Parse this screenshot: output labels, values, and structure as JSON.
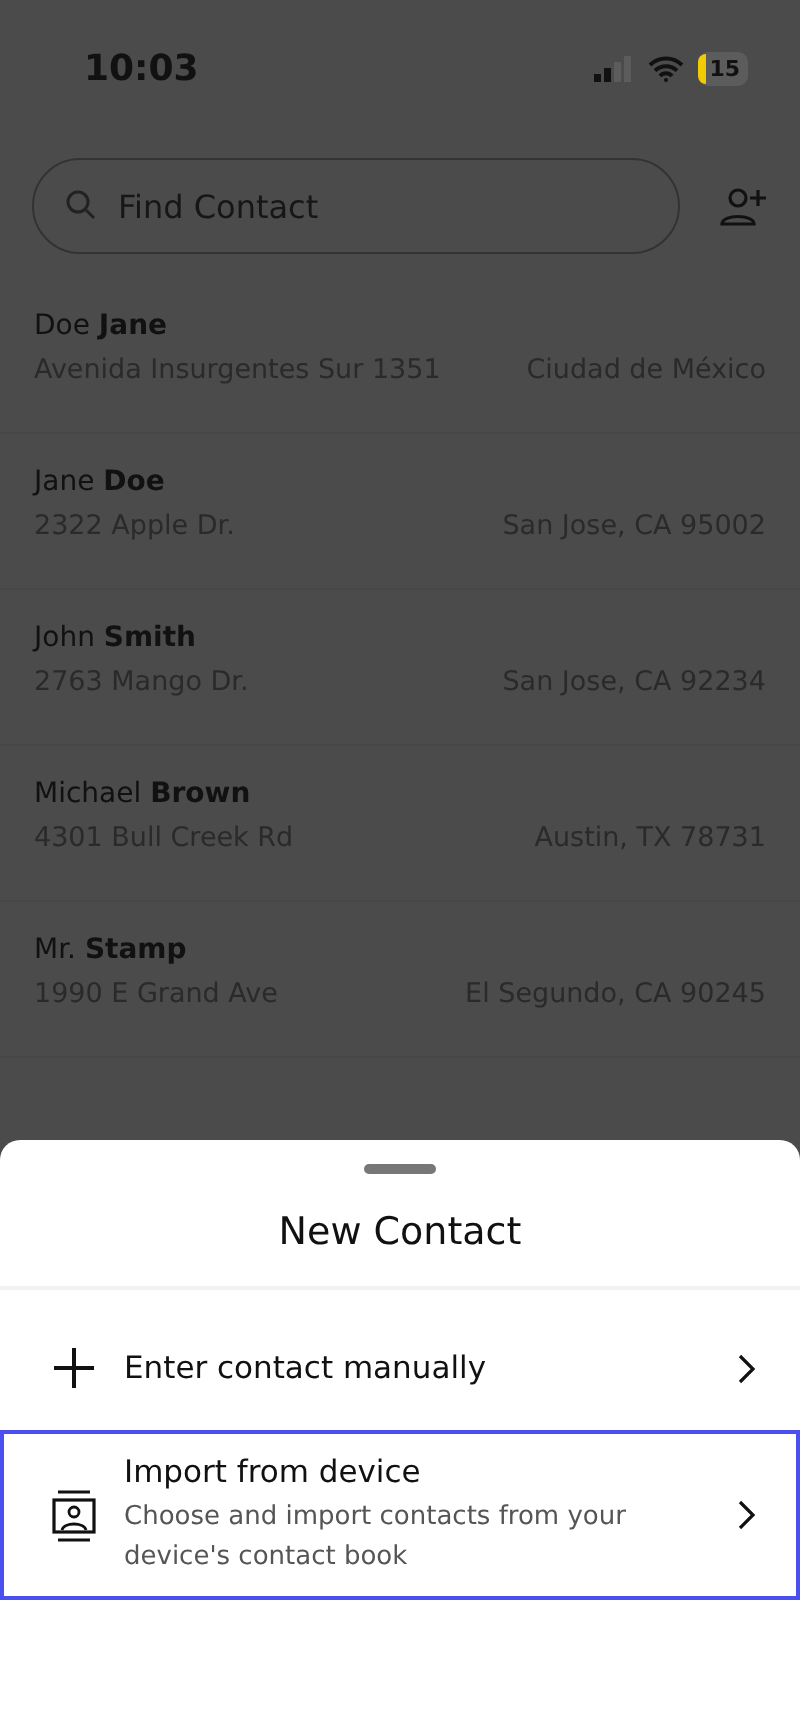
{
  "status_bar": {
    "time": "10:03",
    "battery": "15"
  },
  "search": {
    "placeholder": "Find Contact"
  },
  "contacts": [
    {
      "name": "Doe **Jane**",
      "street": "Avenida Insurgentes Sur 1351",
      "city": "Ciudad de México"
    },
    {
      "name": "Jane **Doe**",
      "street": "2322 Apple Dr.",
      "city": "San Jose, CA 95002"
    },
    {
      "name": "John **Smith**",
      "street": "2763 Mango Dr.",
      "city": "San Jose, CA 92234"
    },
    {
      "name": "Michael **Brown**",
      "street": "4301 Bull Creek Rd",
      "city": "Austin, TX 78731"
    },
    {
      "name": "Mr. **Stamp**",
      "street": "1990 E Grand Ave",
      "city": "El Segundo, CA 90245"
    }
  ],
  "sheet": {
    "title": "New Contact",
    "options": [
      {
        "kind": "manual",
        "label": "Enter contact manually",
        "selected": false
      },
      {
        "kind": "import",
        "label": "Import from device",
        "description": "Choose and import contacts from your device's contact book",
        "selected": true
      }
    ]
  }
}
